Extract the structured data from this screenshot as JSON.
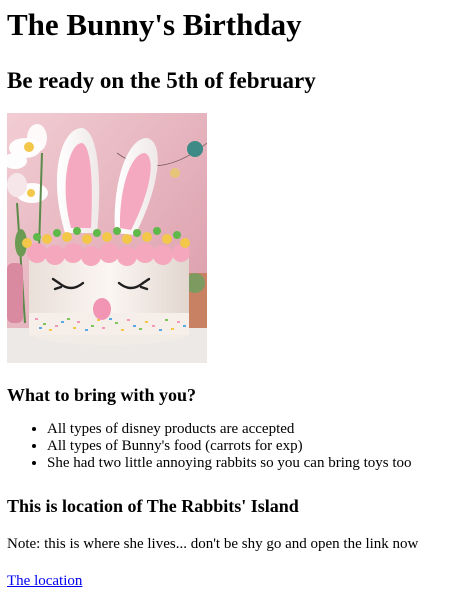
{
  "page": {
    "title": "The Bunny's Birthday",
    "subtitle": "Be ready on the 5th of february",
    "image_alt": "bunny cake"
  },
  "bring": {
    "heading": "What to bring with you?",
    "items": [
      "All types of disney products are accepted",
      "All types of Bunny's food (carrots for exp)",
      "She had two little annoying rabbits so you can bring toys too"
    ]
  },
  "location": {
    "heading": "This is location of The Rabbits' Island",
    "note": "Note: this is where she lives... don't be shy go and open the link now",
    "link_label": "The location"
  },
  "colors": {
    "link": "#0000ee",
    "frosting_pink": "#f4a7bd",
    "background_pink": "#e9b9c3"
  }
}
